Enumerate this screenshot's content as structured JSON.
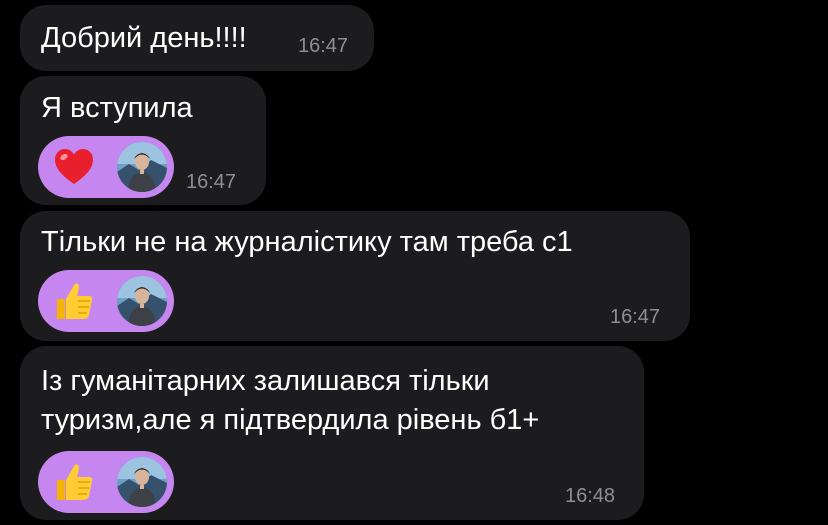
{
  "messages": [
    {
      "text": "Добрий день!!!!",
      "time": "16:47",
      "reaction": null
    },
    {
      "text": "Я вступила",
      "time": "16:47",
      "reaction": {
        "emoji": "heart-icon"
      }
    },
    {
      "text": "Тільки не на журналістику там треба с1",
      "time": "16:47",
      "reaction": {
        "emoji": "thumbs-up-icon"
      }
    },
    {
      "lines": [
        "Із гуманітарних залишався тільки",
        "туризм,але я підтвердила рівень б1+"
      ],
      "time": "16:48",
      "reaction": {
        "emoji": "thumbs-up-icon"
      }
    }
  ],
  "colors": {
    "background": "#000000",
    "bubble": "#1c1c1e",
    "reaction_pill": "#c587ef",
    "timestamp": "#8e8e93",
    "text": "#ffffff"
  }
}
